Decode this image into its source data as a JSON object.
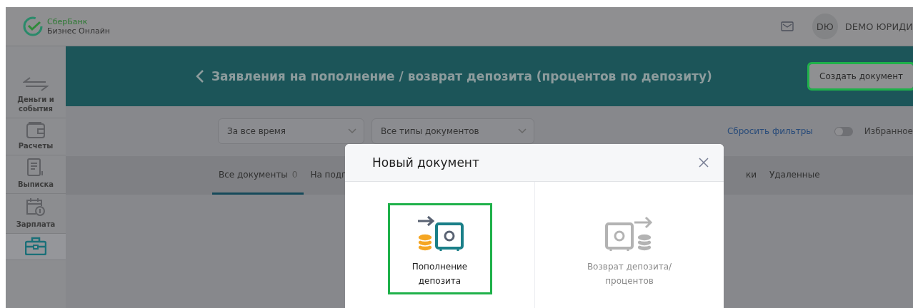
{
  "header": {
    "logo_line1": "СберБанк",
    "logo_line2": "Бизнес Онлайн",
    "avatar": "DЮ",
    "user_name": "DEMO ЮРИДИ"
  },
  "sidebar": {
    "items": [
      {
        "kind": "arrows",
        "label": "Деньги и события",
        "selected": false
      },
      {
        "kind": "wallet",
        "label": "Расчеты",
        "selected": false
      },
      {
        "kind": "statement",
        "label": "Выписка",
        "selected": false
      },
      {
        "kind": "calendar",
        "label": "Зарплата",
        "selected": false
      },
      {
        "kind": "briefcase",
        "selected": true
      }
    ]
  },
  "banner": {
    "title": "Заявления на пополнение / возврат депозита (процентов по депозиту)",
    "button": {
      "label": "Создать документ",
      "highlighted": true
    }
  },
  "filters": {
    "selects": [
      {
        "value": "За все время"
      },
      {
        "value": "Все типы документов"
      }
    ],
    "reset_link": "Сбросить фильтры",
    "favorites": {
      "label": "Избранное",
      "on": false
    }
  },
  "tabs": [
    {
      "label": "Все документы",
      "count": "0",
      "selected": true
    },
    {
      "label": "На подп",
      "selected": false
    },
    {
      "label": "ки",
      "selected": false
    },
    {
      "label": "Удаленные",
      "selected": false
    }
  ],
  "modal": {
    "title": "Новый документ",
    "options": [
      {
        "kind": "deposit-in",
        "label": "Пополнение депозита",
        "selected": true,
        "disabled": false
      },
      {
        "kind": "deposit-out",
        "label": "Возврат депозита/процентов",
        "selected": false,
        "disabled": true
      }
    ]
  }
}
